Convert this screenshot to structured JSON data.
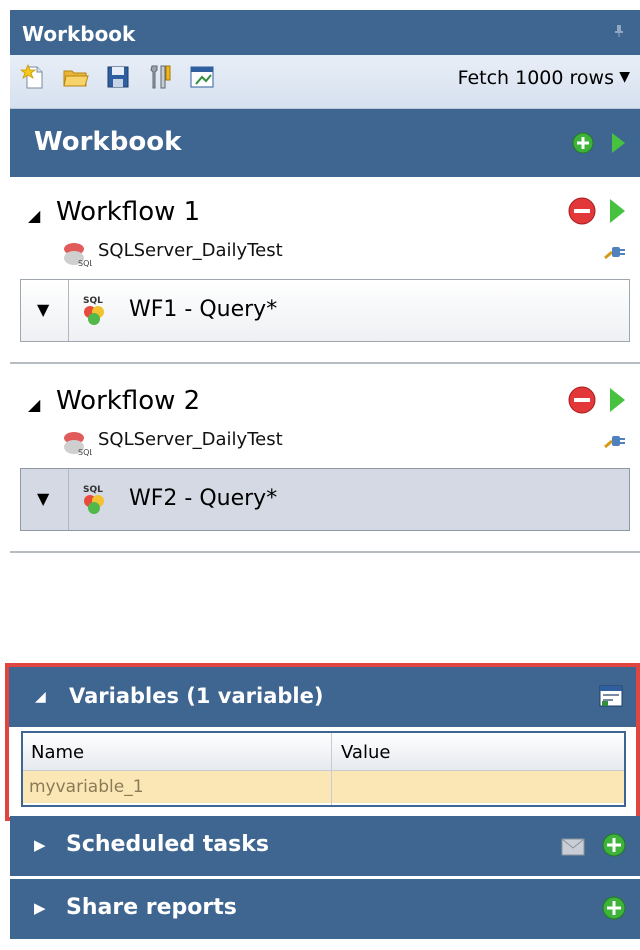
{
  "window": {
    "title": "Workbook"
  },
  "toolbar": {
    "icons": [
      "new-icon",
      "open-folder-icon",
      "save-icon",
      "tools-icon",
      "export-icon"
    ],
    "fetch_label": "Fetch 1000 rows"
  },
  "workbook": {
    "title": "Workbook"
  },
  "workflows": [
    {
      "title": "Workflow 1",
      "connection": "SQLServer_DailyTest",
      "query": "WF1 - Query*",
      "selected": false
    },
    {
      "title": "Workflow 2",
      "connection": "SQLServer_DailyTest",
      "query": "WF2 - Query*",
      "selected": true
    }
  ],
  "variables": {
    "title": "Variables (1 variable)",
    "columns": [
      "Name",
      "Value"
    ],
    "rows": [
      {
        "name": "myvariable_1",
        "value": ""
      }
    ]
  },
  "panels": {
    "scheduled": {
      "label": "Scheduled tasks"
    },
    "share": {
      "label": "Share reports"
    }
  },
  "colors": {
    "header_blue": "#3f6591",
    "highlight_red": "#e0463f",
    "row_yellow": "#fbe7b5"
  }
}
